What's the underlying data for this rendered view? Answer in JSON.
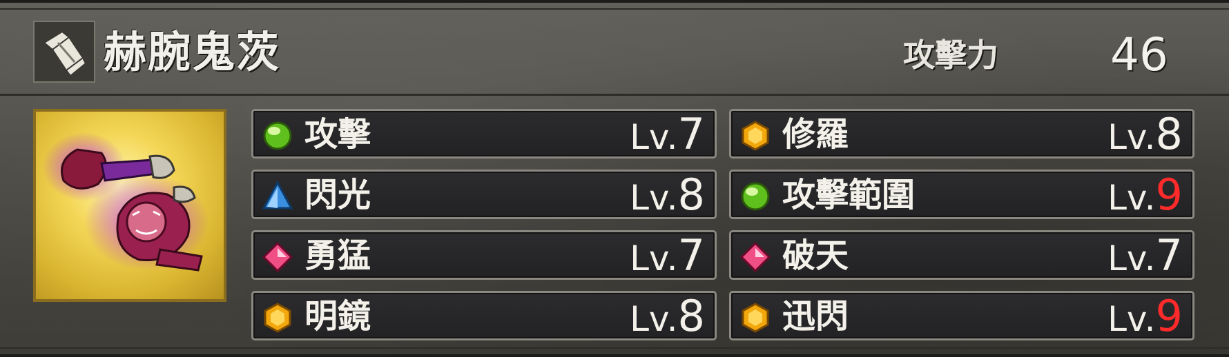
{
  "header": {
    "weapon_name": "赫腕鬼茨",
    "attack_label": "攻擊力",
    "attack_value": "46",
    "weapon_icon": "gauntlet-icon"
  },
  "portrait": {
    "icon": "oni-gauntlet-weapon-art"
  },
  "colors": {
    "gem_green": "#5fbf1c",
    "gem_blue": "#3a8fe0",
    "gem_pink": "#f04f86",
    "gem_gold": "#f2a70c",
    "level_max": "#ff2a2a"
  },
  "skills": [
    {
      "name": "攻擊",
      "level_prefix": "Lv.",
      "level": "7",
      "gem": "green-orb-icon",
      "max": false
    },
    {
      "name": "修羅",
      "level_prefix": "Lv.",
      "level": "8",
      "gem": "gold-hexagon-icon",
      "max": false
    },
    {
      "name": "閃光",
      "level_prefix": "Lv.",
      "level": "8",
      "gem": "blue-pyramid-icon",
      "max": false
    },
    {
      "name": "攻擊範圍",
      "level_prefix": "Lv.",
      "level": "9",
      "gem": "green-orb-icon",
      "max": true
    },
    {
      "name": "勇猛",
      "level_prefix": "Lv.",
      "level": "7",
      "gem": "pink-diamond-icon",
      "max": false
    },
    {
      "name": "破天",
      "level_prefix": "Lv.",
      "level": "7",
      "gem": "pink-diamond-icon",
      "max": false
    },
    {
      "name": "明鏡",
      "level_prefix": "Lv.",
      "level": "8",
      "gem": "gold-hexagon-icon",
      "max": false
    },
    {
      "name": "迅閃",
      "level_prefix": "Lv.",
      "level": "9",
      "gem": "gold-hexagon-icon",
      "max": true
    }
  ]
}
